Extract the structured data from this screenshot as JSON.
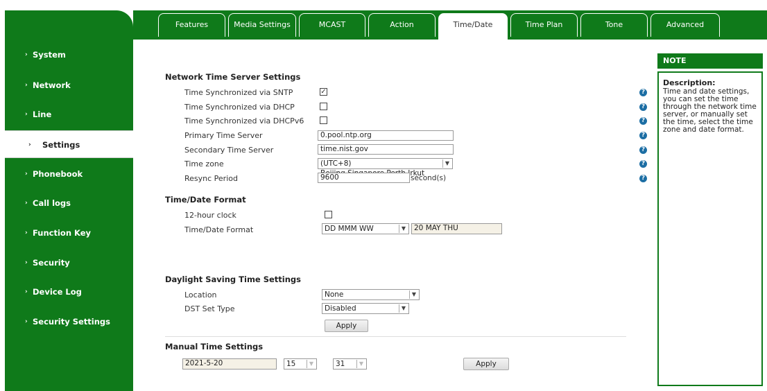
{
  "tabs": [
    {
      "label": "Features"
    },
    {
      "label": "Media Settings"
    },
    {
      "label": "MCAST"
    },
    {
      "label": "Action"
    },
    {
      "label": "Time/Date",
      "active": true
    },
    {
      "label": "Time Plan"
    },
    {
      "label": "Tone"
    },
    {
      "label": "Advanced"
    }
  ],
  "sidebar": {
    "items": [
      {
        "label": "System"
      },
      {
        "label": "Network"
      },
      {
        "label": "Line"
      },
      {
        "label": "Settings",
        "active": true
      },
      {
        "label": "Phonebook"
      },
      {
        "label": "Call logs"
      },
      {
        "label": "Function Key"
      },
      {
        "label": "Security"
      },
      {
        "label": "Device Log"
      },
      {
        "label": "Security Settings"
      }
    ]
  },
  "network_time": {
    "title": "Network Time Server Settings",
    "sntp_label": "Time Synchronized via SNTP",
    "sntp_checked": true,
    "dhcp_label": "Time Synchronized via DHCP",
    "dhcp_checked": false,
    "dhcpv6_label": "Time Synchronized via DHCPv6",
    "dhcpv6_checked": false,
    "primary_label": "Primary Time Server",
    "primary_value": "0.pool.ntp.org",
    "secondary_label": "Secondary Time Server",
    "secondary_value": "time.nist.gov",
    "timezone_label": "Time zone",
    "timezone_value": "(UTC+8) Beijing,Singapore,Perth,Irkut",
    "resync_label": "Resync Period",
    "resync_value": "9600",
    "resync_unit": "second(s)"
  },
  "format": {
    "title": "Time/Date Format",
    "clock_label": "12-hour clock",
    "clock_checked": false,
    "format_label": "Time/Date Format",
    "format_value": "DD MMM WW",
    "format_preview": "20 MAY THU"
  },
  "dst": {
    "title": "Daylight Saving Time Settings",
    "location_label": "Location",
    "location_value": "None",
    "type_label": "DST Set Type",
    "type_value": "Disabled",
    "apply_label": "Apply"
  },
  "manual": {
    "title": "Manual Time Settings",
    "date_value": "2021-5-20",
    "hour_value": "15",
    "minute_value": "31",
    "apply_label": "Apply"
  },
  "note": {
    "title": "NOTE",
    "heading": "Description:",
    "text": "Time and date settings, you can set the time through the network time server, or manually set the time, select the time zone and date format."
  },
  "icons": {
    "help": "help-circle-icon",
    "check": "checkmark-icon",
    "dropdown": "chevron-down-icon",
    "arrow": "chevron-right-icon"
  },
  "colors": {
    "brand_green": "#0f7a1a",
    "help_blue": "#1c6ea4"
  }
}
